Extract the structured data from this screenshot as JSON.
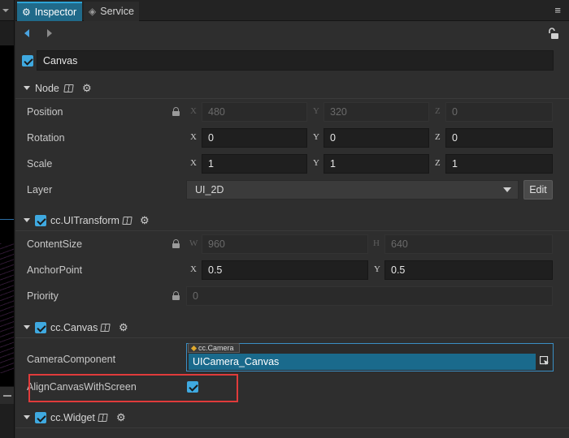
{
  "tabs": [
    {
      "label": "Inspector",
      "icon": "gear-icon",
      "active": true
    },
    {
      "label": "Service",
      "icon": "eye-icon",
      "active": false
    }
  ],
  "node": {
    "enabled": true,
    "name": "Canvas"
  },
  "sections": {
    "node": {
      "title": "Node",
      "expanded": true
    },
    "uitransform": {
      "title": "cc.UITransform",
      "enabled": true,
      "expanded": true
    },
    "canvas": {
      "title": "cc.Canvas",
      "enabled": true,
      "expanded": true
    },
    "widget": {
      "title": "cc.Widget",
      "enabled": true,
      "expanded": true
    }
  },
  "properties": {
    "position": {
      "label": "Position",
      "locked": true,
      "axes": [
        "X",
        "Y",
        "Z"
      ],
      "values": [
        "480",
        "320",
        "0"
      ]
    },
    "rotation": {
      "label": "Rotation",
      "axes": [
        "X",
        "Y",
        "Z"
      ],
      "values": [
        "0",
        "0",
        "0"
      ]
    },
    "scale": {
      "label": "Scale",
      "axes": [
        "X",
        "Y",
        "Z"
      ],
      "values": [
        "1",
        "1",
        "1"
      ]
    },
    "layer": {
      "label": "Layer",
      "value": "UI_2D",
      "edit_label": "Edit"
    },
    "content_size": {
      "label": "ContentSize",
      "locked": true,
      "axes": [
        "W",
        "H"
      ],
      "values": [
        "960",
        "640"
      ]
    },
    "anchor_point": {
      "label": "AnchorPoint",
      "axes": [
        "X",
        "Y"
      ],
      "values": [
        "0.5",
        "0.5"
      ]
    },
    "priority": {
      "label": "Priority",
      "locked": true,
      "value": "0"
    },
    "camera_component": {
      "label": "CameraComponent",
      "type_tag": "cc.Camera",
      "value": "UICamera_Canvas"
    },
    "align_canvas": {
      "label": "AlignCanvasWithScreen",
      "checked": true
    }
  },
  "colors": {
    "accent": "#3fa9e0",
    "tab_active": "#206a8a",
    "highlight": "#e03b3b",
    "asset_field": "#1a6a8c"
  }
}
